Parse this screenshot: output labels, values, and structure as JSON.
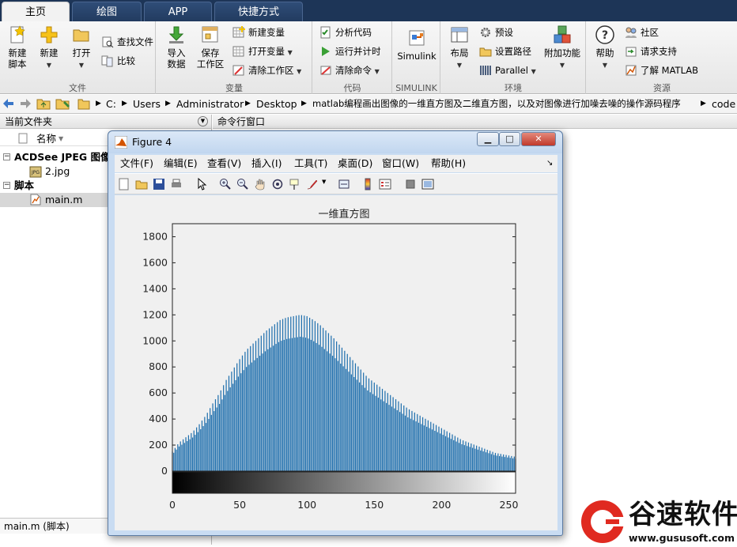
{
  "tabs": [
    {
      "label": "主页",
      "active": true
    },
    {
      "label": "绘图",
      "active": false
    },
    {
      "label": "APP",
      "active": false
    },
    {
      "label": "快捷方式",
      "active": false
    }
  ],
  "ribbon": {
    "file": {
      "label": "文件",
      "new_script_line1": "新建",
      "new_script_line2": "脚本",
      "new": "新建",
      "open": "打开",
      "find_files": "查找文件",
      "compare": "比较"
    },
    "variable": {
      "label": "变量",
      "import_line1": "导入",
      "import_line2": "数据",
      "save_ws_line1": "保存",
      "save_ws_line2": "工作区",
      "new_var": "新建变量",
      "open_var": "打开变量",
      "clear_ws": "清除工作区"
    },
    "code": {
      "label": "代码",
      "analyze": "分析代码",
      "run_time": "运行并计时",
      "clear_cmd": "清除命令"
    },
    "simulink": {
      "label": "SIMULINK",
      "simulink": "Simulink"
    },
    "environment": {
      "label": "环境",
      "layout": "布局",
      "preferences": "预设",
      "set_path": "设置路径",
      "parallel": "Parallel",
      "addons": "附加功能"
    },
    "resources": {
      "label": "资源",
      "help": "帮助",
      "community": "社区",
      "request_support": "请求支持",
      "learn_matlab": "了解 MATLAB"
    }
  },
  "address": {
    "segments": [
      "C:",
      "Users",
      "Administrator",
      "Desktop",
      "matlab编程画出图像的一维直方图及二维直方图，以及对图像进行加噪去噪的操作源码程序",
      "code"
    ]
  },
  "current_folder": {
    "title": "当前文件夹",
    "column_name": "名称",
    "groups": [
      {
        "label": "ACDSee JPEG 图像",
        "items": [
          "2.jpg"
        ]
      },
      {
        "label": "脚本",
        "items": [
          "main.m"
        ]
      }
    ],
    "status": "main.m  (脚本)"
  },
  "command_window": {
    "title": "命令行窗口"
  },
  "figure": {
    "title": "Figure 4",
    "menus": [
      "文件(F)",
      "编辑(E)",
      "查看(V)",
      "插入(I)",
      "工具(T)",
      "桌面(D)",
      "窗口(W)",
      "帮助(H)"
    ]
  },
  "chart_data": {
    "type": "bar",
    "title": "一维直方图",
    "xlabel": "",
    "ylabel": "",
    "xlim": [
      0,
      255
    ],
    "ylim": [
      0,
      1900
    ],
    "xticks": [
      0,
      50,
      100,
      150,
      200,
      250
    ],
    "yticks": [
      0,
      200,
      400,
      600,
      800,
      1000,
      1200,
      1400,
      1600,
      1800
    ],
    "bar_color": "#1f6fad",
    "colorbar": "gray",
    "x": [
      0,
      5,
      10,
      15,
      20,
      25,
      30,
      35,
      40,
      45,
      50,
      55,
      60,
      65,
      70,
      75,
      80,
      85,
      90,
      95,
      100,
      105,
      110,
      115,
      120,
      125,
      130,
      135,
      140,
      145,
      150,
      155,
      160,
      165,
      170,
      175,
      180,
      185,
      190,
      195,
      200,
      205,
      210,
      215,
      220,
      225,
      230,
      235,
      240,
      245,
      250,
      255
    ],
    "values": [
      150,
      220,
      260,
      300,
      360,
      430,
      520,
      600,
      700,
      780,
      860,
      930,
      980,
      1030,
      1080,
      1120,
      1160,
      1180,
      1190,
      1200,
      1190,
      1160,
      1120,
      1070,
      1020,
      960,
      900,
      840,
      780,
      720,
      680,
      640,
      600,
      560,
      520,
      480,
      450,
      420,
      390,
      360,
      330,
      300,
      270,
      240,
      220,
      200,
      180,
      160,
      140,
      130,
      120,
      110
    ]
  },
  "watermark": {
    "brand": "谷速软件",
    "url": "www.gususoft.com"
  }
}
